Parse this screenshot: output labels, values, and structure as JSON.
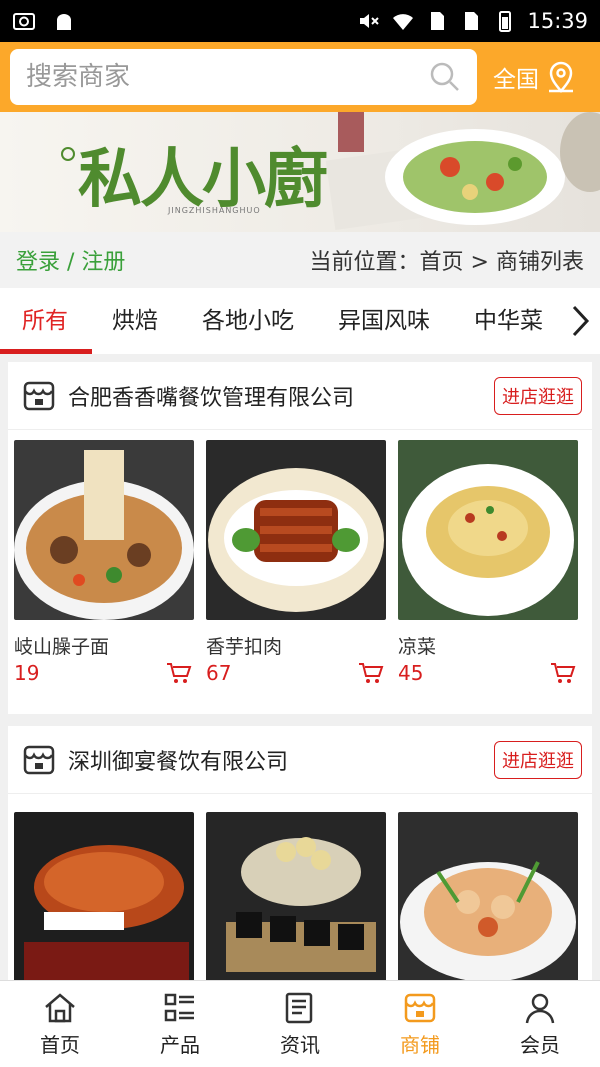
{
  "status_bar": {
    "time": "15:39",
    "icons": [
      "screenshot-icon",
      "android-icon",
      "mute-icon",
      "wifi-icon",
      "sim1-icon",
      "sim2-icon",
      "battery-icon"
    ]
  },
  "search": {
    "placeholder": "搜索商家",
    "region_label": "全国"
  },
  "banner": {
    "logo_text": "私人小廚",
    "logo_sub": "JINGZHISHANGHUO"
  },
  "breadcrumb": {
    "login": "登录",
    "separator": " / ",
    "register": "注册",
    "prefix": "当前位置：",
    "home": "首页",
    "arrow": " > ",
    "current": "商铺列表"
  },
  "categories": [
    "所有",
    "烘焙",
    "各地小吃",
    "异国风味",
    "中华菜"
  ],
  "shops": [
    {
      "name": "合肥香香嘴餐饮管理有限公司",
      "visit_label": "进店逛逛",
      "products": [
        {
          "name": "岐山臊子面",
          "price": "19"
        },
        {
          "name": "香芋扣肉",
          "price": "67"
        },
        {
          "name": "凉菜",
          "price": "45"
        }
      ]
    },
    {
      "name": "深圳御宴餐饮有限公司",
      "visit_label": "进店逛逛",
      "products": [
        {
          "name": "",
          "price": ""
        },
        {
          "name": "",
          "price": ""
        },
        {
          "name": "",
          "price": ""
        }
      ]
    }
  ],
  "bottom_nav": [
    "首页",
    "产品",
    "资讯",
    "商铺",
    "会员"
  ],
  "colors": {
    "accent_orange": "#fca82a",
    "price_red": "#d81e1e",
    "login_green": "#3aa03a",
    "nav_active": "#f39a1d"
  }
}
